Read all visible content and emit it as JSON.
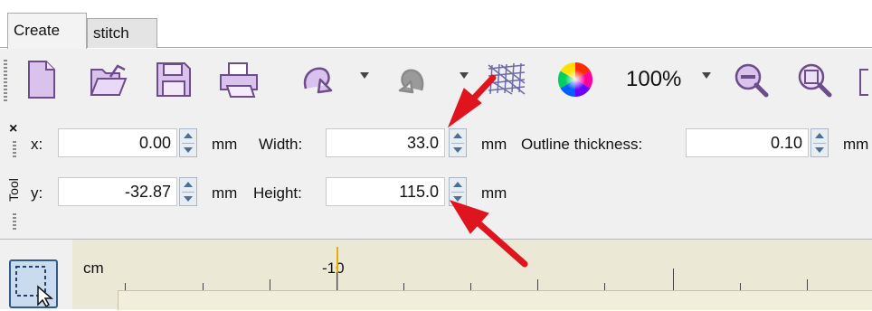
{
  "tabs": [
    {
      "label": "Create",
      "active": true
    },
    {
      "label": "stitch",
      "active": false
    }
  ],
  "toolbar": {
    "buttons": [
      {
        "name": "new-document-icon"
      },
      {
        "name": "open-folder-icon"
      },
      {
        "name": "save-disk-icon"
      },
      {
        "name": "print-icon"
      },
      {
        "name": "undo-icon"
      },
      {
        "name": "redo-icon"
      },
      {
        "name": "stitch-preview-icon"
      },
      {
        "name": "color-wheel-icon"
      },
      {
        "name": "zoom-out-icon"
      },
      {
        "name": "zoom-fit-icon"
      }
    ],
    "zoom": "100%"
  },
  "properties": {
    "x_label": "x:",
    "x_value": "0.00",
    "y_label": "y:",
    "y_value": "-32.87",
    "unit": "mm",
    "width_label": "Width:",
    "width_value": "33.0",
    "height_label": "Height:",
    "height_value": "115.0",
    "outline_label": "Outline thickness:",
    "outline_value": "0.10",
    "panel_label": "Tool"
  },
  "ruler": {
    "unit": "cm",
    "label": "-10"
  },
  "colors": {
    "annotation_arrow": "#e0141e",
    "toolbar_bg": "#f0f0f0",
    "ruler_bg": "#ece8d6",
    "spinner": "#4d6f96"
  }
}
